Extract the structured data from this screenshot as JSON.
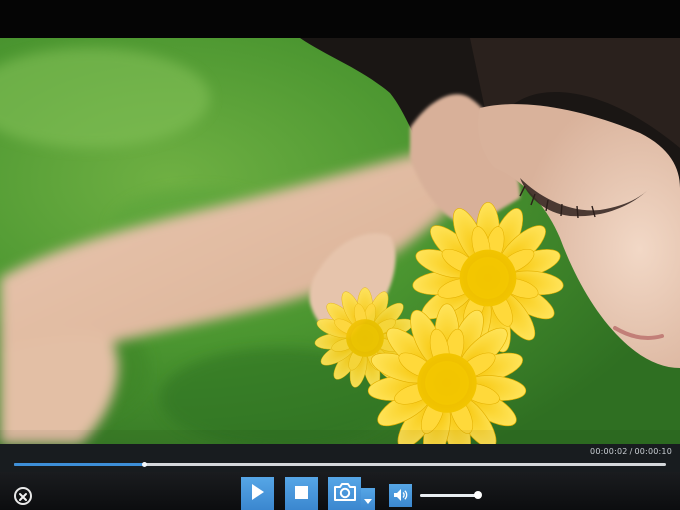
{
  "player": {
    "time": {
      "current": "00:00:02",
      "separator": "/",
      "total": "00:00:10"
    },
    "seek": {
      "progress_fraction": 0.2
    },
    "volume": {
      "level_fraction": 1.0
    },
    "controls": {
      "close_icon": "close-circle-icon",
      "play_icon": "play-icon",
      "stop_icon": "stop-icon",
      "snapshot_icon": "camera-icon",
      "snapshot_menu_icon": "caret-down-icon",
      "volume_icon": "speaker-icon"
    },
    "colors": {
      "accent": "#3d8fd8",
      "button": "#4a9ae0",
      "bar_bg": "#111315"
    }
  }
}
